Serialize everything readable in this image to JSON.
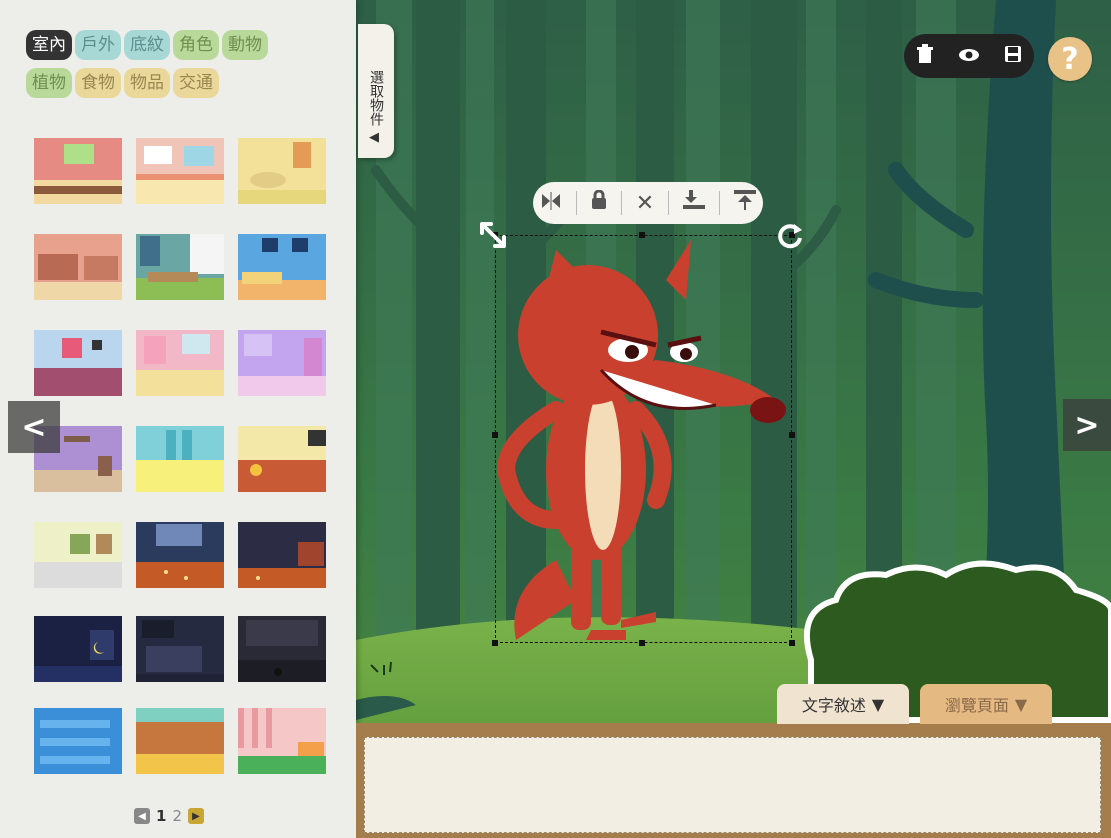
{
  "categories": [
    {
      "label": "室內",
      "bg": "#333333",
      "fg": "#ffffff"
    },
    {
      "label": "戶外",
      "bg": "#a8d8d6",
      "fg": "#5b8f8c"
    },
    {
      "label": "底紋",
      "bg": "#a8d8d6",
      "fg": "#5b8f8c"
    },
    {
      "label": "角色",
      "bg": "#b9d99a",
      "fg": "#6e8f4e"
    },
    {
      "label": "動物",
      "bg": "#b9d99a",
      "fg": "#6e8f4e"
    },
    {
      "label": "植物",
      "bg": "#b9d99a",
      "fg": "#6e8f4e"
    },
    {
      "label": "食物",
      "bg": "#ead79a",
      "fg": "#9b8650"
    },
    {
      "label": "物品",
      "bg": "#ead79a",
      "fg": "#9b8650"
    },
    {
      "label": "交通",
      "bg": "#ead79a",
      "fg": "#9b8650"
    }
  ],
  "select_tab": {
    "label": "選取物件",
    "arrow": "◀"
  },
  "pager": {
    "prev": "◀",
    "page1": "1",
    "page2": "2",
    "next": "▶"
  },
  "nav": {
    "prev": "<",
    "next": ">"
  },
  "toolbar": {
    "trash_icon": "trash-icon",
    "eye_icon": "eye-icon",
    "save_icon": "save-icon"
  },
  "help": {
    "label": "?"
  },
  "object_tools": {
    "flip": "⏮",
    "lock": "🔒",
    "delete": "✕",
    "send_back": "⤓",
    "bring_front": "⤒"
  },
  "bottom_tabs": {
    "text": "文字敘述",
    "pages": "瀏覽頁面"
  },
  "text_content": ""
}
